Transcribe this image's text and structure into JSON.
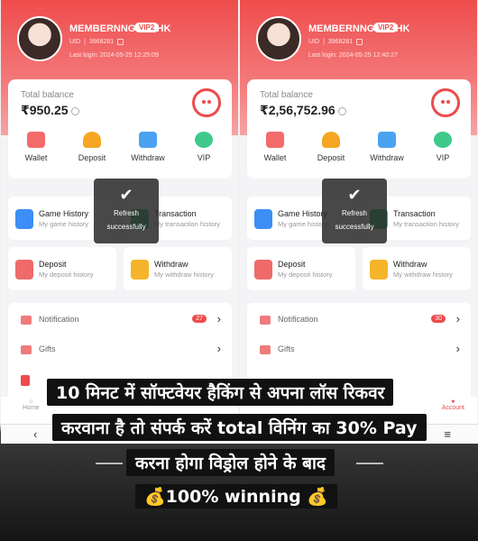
{
  "panels": [
    {
      "username": "MEMBERNNGYMFHK",
      "badge": "VIP2",
      "uid_label": "UID",
      "uid": "3968281",
      "last_login": "Last login: 2024-05-25 12:25:09",
      "balance_label": "Total balance",
      "balance": "₹950.25"
    },
    {
      "username": "MEMBERNNGYMFHK",
      "badge": "VIP2",
      "uid_label": "UID",
      "uid": "3968281",
      "last_login": "Last login: 2024-05-25 12:40:27",
      "balance_label": "Total balance",
      "balance": "₹2,56,752.96"
    }
  ],
  "quick_actions": [
    "Wallet",
    "Deposit",
    "Withdraw",
    "VIP"
  ],
  "features": {
    "game_history": {
      "title": "Game History",
      "sub": "My game history"
    },
    "transaction": {
      "title": "Transaction",
      "sub": "My transaction history"
    },
    "deposit": {
      "title": "Deposit",
      "sub": "My deposit history"
    },
    "withdraw": {
      "title": "Withdraw",
      "sub": "My withdraw history"
    }
  },
  "menu": {
    "notification": "Notification",
    "notif_badges": [
      "27",
      "30"
    ],
    "gifts": "Gifts"
  },
  "toast": {
    "check": "✔",
    "text1": "Refresh",
    "text2": "successfully"
  },
  "nav": {
    "home": "Home",
    "account": "Account"
  },
  "overlay": {
    "line1": "10 मिनट में सॉफ्टवेयर हैकिंग से अपना लॉस रिकवर",
    "line2": "करवाना है तो संपर्क करें total विनिंग का 30% Pay",
    "line3": "करना होगा विड्रोल होने के बाद",
    "line4": "💰100% winning 💰"
  },
  "colors": {
    "accent": "#ee4b4b"
  }
}
